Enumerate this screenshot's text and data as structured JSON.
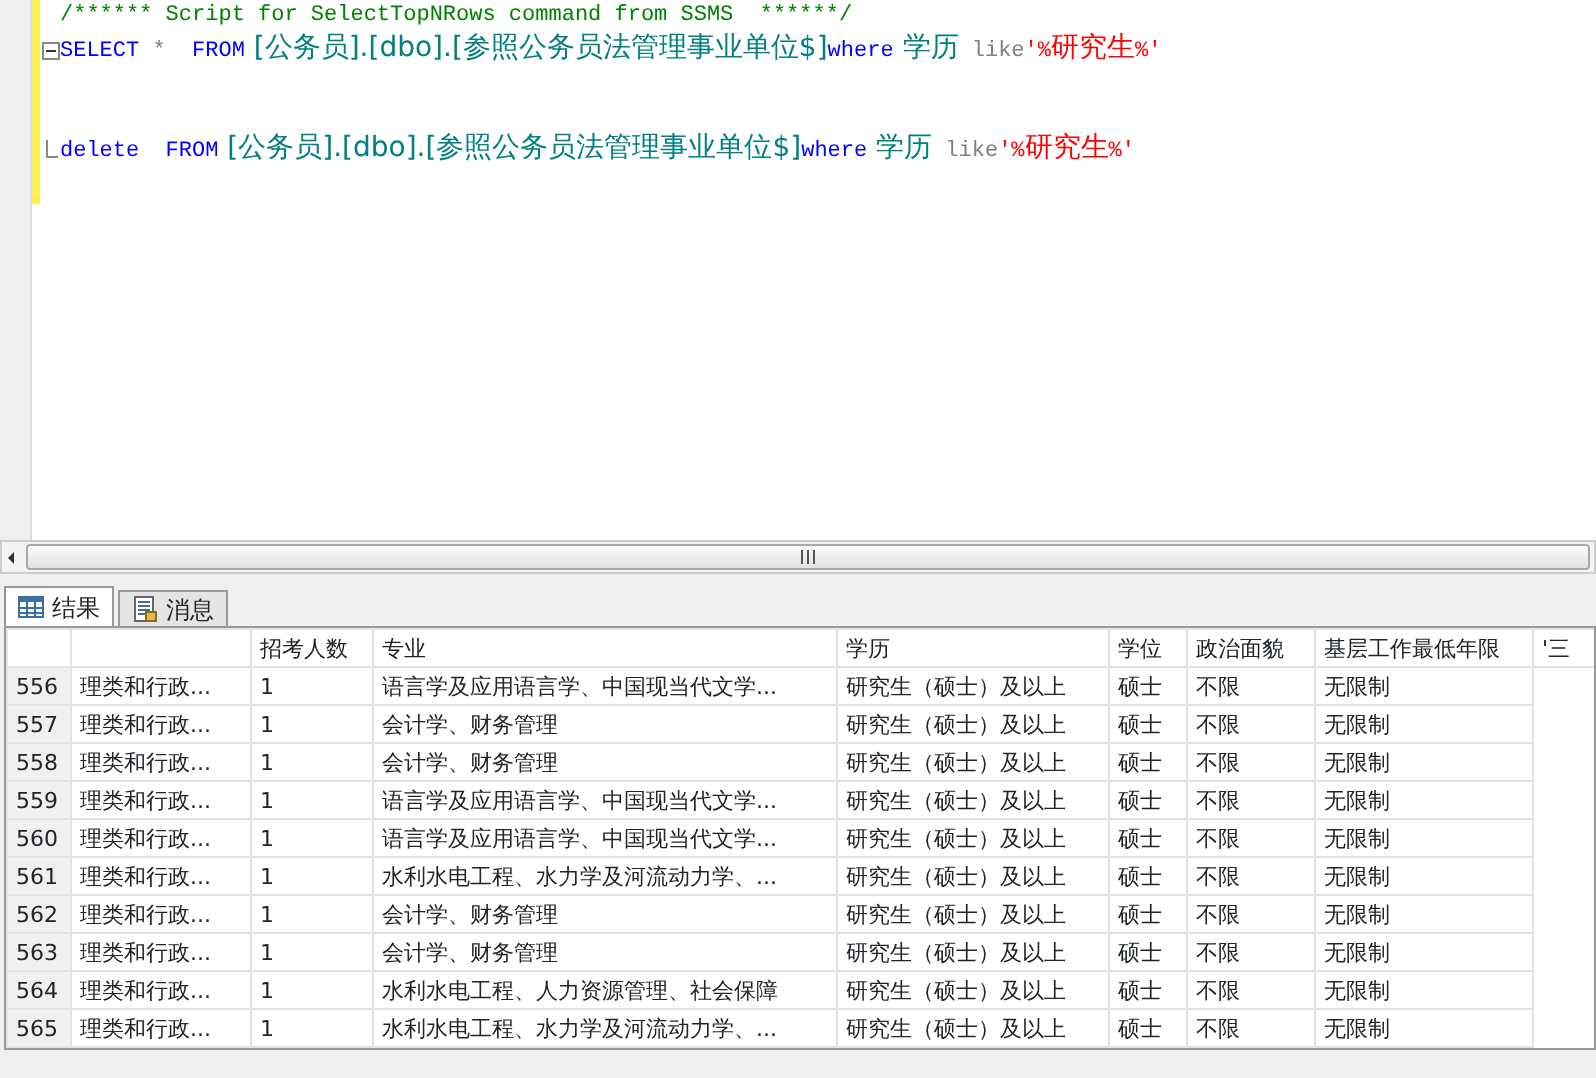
{
  "editor": {
    "lines": [
      {
        "kind": "plain",
        "tokens": [
          {
            "kind": "comment",
            "text": "/****** Script for SelectTopNRows command from SSMS  ******/"
          }
        ]
      },
      {
        "kind": "fold_start",
        "tokens": [
          {
            "kind": "keyword",
            "text": "SELECT"
          },
          {
            "kind": "operator",
            "text": " *"
          },
          {
            "kind": "keyword",
            "text": "  FROM"
          },
          {
            "kind": "identifier",
            "text": " [公务员].[dbo].[参照公务员法管理事业单位$]"
          },
          {
            "kind": "keyword",
            "text": "where"
          },
          {
            "kind": "identifier",
            "text": " 学历"
          },
          {
            "kind": "operator",
            "text": " like"
          },
          {
            "kind": "string",
            "text": "'%研究生%'"
          }
        ]
      },
      {
        "kind": "fold_end",
        "tokens": [
          {
            "kind": "keyword",
            "text": "delete"
          },
          {
            "kind": "keyword",
            "text": "  FROM"
          },
          {
            "kind": "identifier",
            "text": " [公务员].[dbo].[参照公务员法管理事业单位$]"
          },
          {
            "kind": "keyword",
            "text": "where"
          },
          {
            "kind": "identifier",
            "text": " 学历"
          },
          {
            "kind": "operator",
            "text": " like"
          },
          {
            "kind": "string",
            "text": "'%研究生%'"
          }
        ]
      }
    ]
  },
  "result_tabs": [
    {
      "label": "结果",
      "kind": "grid",
      "selected": true
    },
    {
      "label": "消息",
      "kind": "messages",
      "selected": false
    }
  ],
  "table": {
    "columns": [
      "",
      "",
      "招考人数",
      "专业",
      "学历",
      "学位",
      "政治面貌",
      "基层工作最低年限",
      "'三"
    ],
    "rows": [
      [
        "556",
        "理类和行政...",
        "1",
        "语言学及应用语言学、中国现当代文学...",
        "研究生（硕士）及以上",
        "硕士",
        "不限",
        "无限制"
      ],
      [
        "557",
        "理类和行政...",
        "1",
        "会计学、财务管理",
        "研究生（硕士）及以上",
        "硕士",
        "不限",
        "无限制"
      ],
      [
        "558",
        "理类和行政...",
        "1",
        "会计学、财务管理",
        "研究生（硕士）及以上",
        "硕士",
        "不限",
        "无限制"
      ],
      [
        "559",
        "理类和行政...",
        "1",
        "语言学及应用语言学、中国现当代文学...",
        "研究生（硕士）及以上",
        "硕士",
        "不限",
        "无限制"
      ],
      [
        "560",
        "理类和行政...",
        "1",
        "语言学及应用语言学、中国现当代文学...",
        "研究生（硕士）及以上",
        "硕士",
        "不限",
        "无限制"
      ],
      [
        "561",
        "理类和行政...",
        "1",
        "水利水电工程、水力学及河流动力学、...",
        "研究生（硕士）及以上",
        "硕士",
        "不限",
        "无限制"
      ],
      [
        "562",
        "理类和行政...",
        "1",
        "会计学、财务管理",
        "研究生（硕士）及以上",
        "硕士",
        "不限",
        "无限制"
      ],
      [
        "563",
        "理类和行政...",
        "1",
        "会计学、财务管理",
        "研究生（硕士）及以上",
        "硕士",
        "不限",
        "无限制"
      ],
      [
        "564",
        "理类和行政...",
        "1",
        "水利水电工程、人力资源管理、社会保障",
        "研究生（硕士）及以上",
        "硕士",
        "不限",
        "无限制"
      ],
      [
        "565",
        "理类和行政...",
        "1",
        "水利水电工程、水力学及河流动力学、...",
        "研究生（硕士）及以上",
        "硕士",
        "不限",
        "无限制"
      ]
    ]
  }
}
